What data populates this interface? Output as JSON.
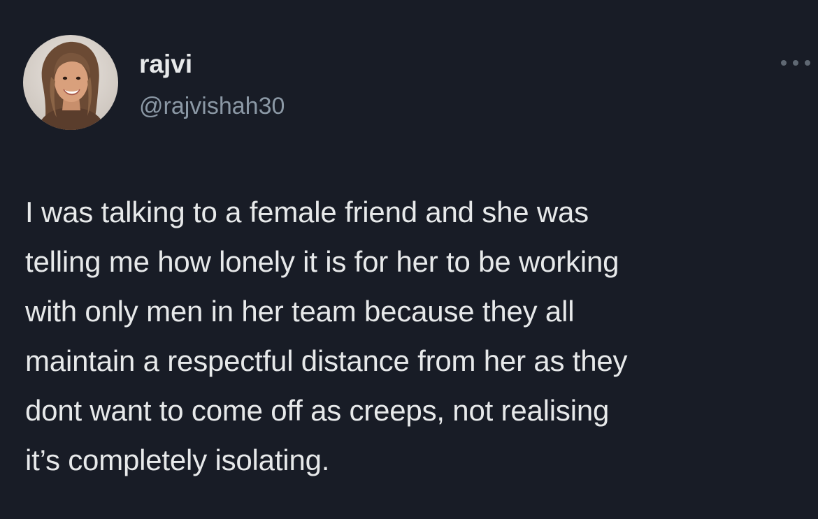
{
  "author": {
    "display_name": "rajvi",
    "handle": "@rajvishah30",
    "avatar_icon": "profile-photo"
  },
  "header": {
    "more_icon": "more-options-icon"
  },
  "tweet": {
    "text": "I was talking to a female friend and she was\ntelling me how lonely it is for her to be working\nwith only men in her team because they all\nmaintain a respectful distance from her as they\ndont want to come off as creeps, not realising\nit’s completely isolating."
  },
  "colors": {
    "background": "#181c26",
    "primary_text": "#e7e9ea",
    "secondary_text": "#8b98a5"
  }
}
